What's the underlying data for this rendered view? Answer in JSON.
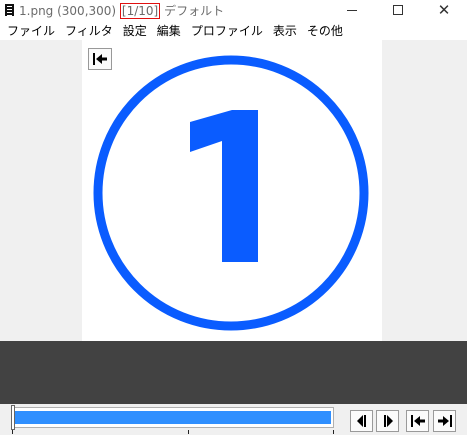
{
  "window": {
    "filename": "1.png (300,300)",
    "frame_indicator": "[1/10]",
    "profile": "デフォルト",
    "minimize_icon": "minimize-icon",
    "maximize_icon": "maximize-icon",
    "close_icon": "close-icon"
  },
  "menu": [
    "ファイル",
    "フィルタ",
    "設定",
    "編集",
    "プロファイル",
    "表示",
    "その他"
  ],
  "image": {
    "content": "1",
    "color": "#0a5cff"
  },
  "colors": {
    "seek_fill": "#2f8fff",
    "indicator_border": "#e01010",
    "dark_band": "#424242"
  },
  "seekbar": {
    "progress": 1.0
  },
  "controls": [
    "prev-frame-icon",
    "next-frame-icon",
    "jump-first-icon",
    "jump-last-icon"
  ],
  "canvas_jump_icon": "jump-first-icon"
}
